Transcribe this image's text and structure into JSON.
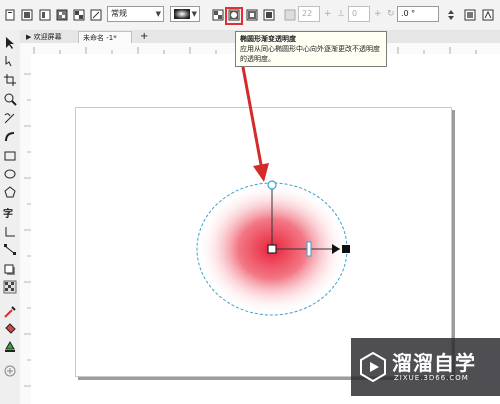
{
  "toolbar": {
    "style_select": "常规",
    "opacity_value": "22",
    "angle_value": "0",
    "rotation_value": ".0 °"
  },
  "document_tabs": [
    {
      "label": "欢迎屏幕"
    },
    {
      "label": "未命名 -1*"
    }
  ],
  "tooltip": {
    "title": "椭圆形渐变透明度",
    "description": "应用从同心椭圆形中心向外逐渐更改不透明度的透明度。"
  },
  "watermark": {
    "brand": "溜溜自学",
    "url": "ZIXUE.3D66.COM"
  },
  "colors": {
    "highlight": "#e03030",
    "gradient_center": "#e8203a",
    "dashed_ellipse": "#3aa0d0",
    "arrow": "#d42a2a"
  },
  "icons": {
    "tab_new": "plus-icon"
  }
}
